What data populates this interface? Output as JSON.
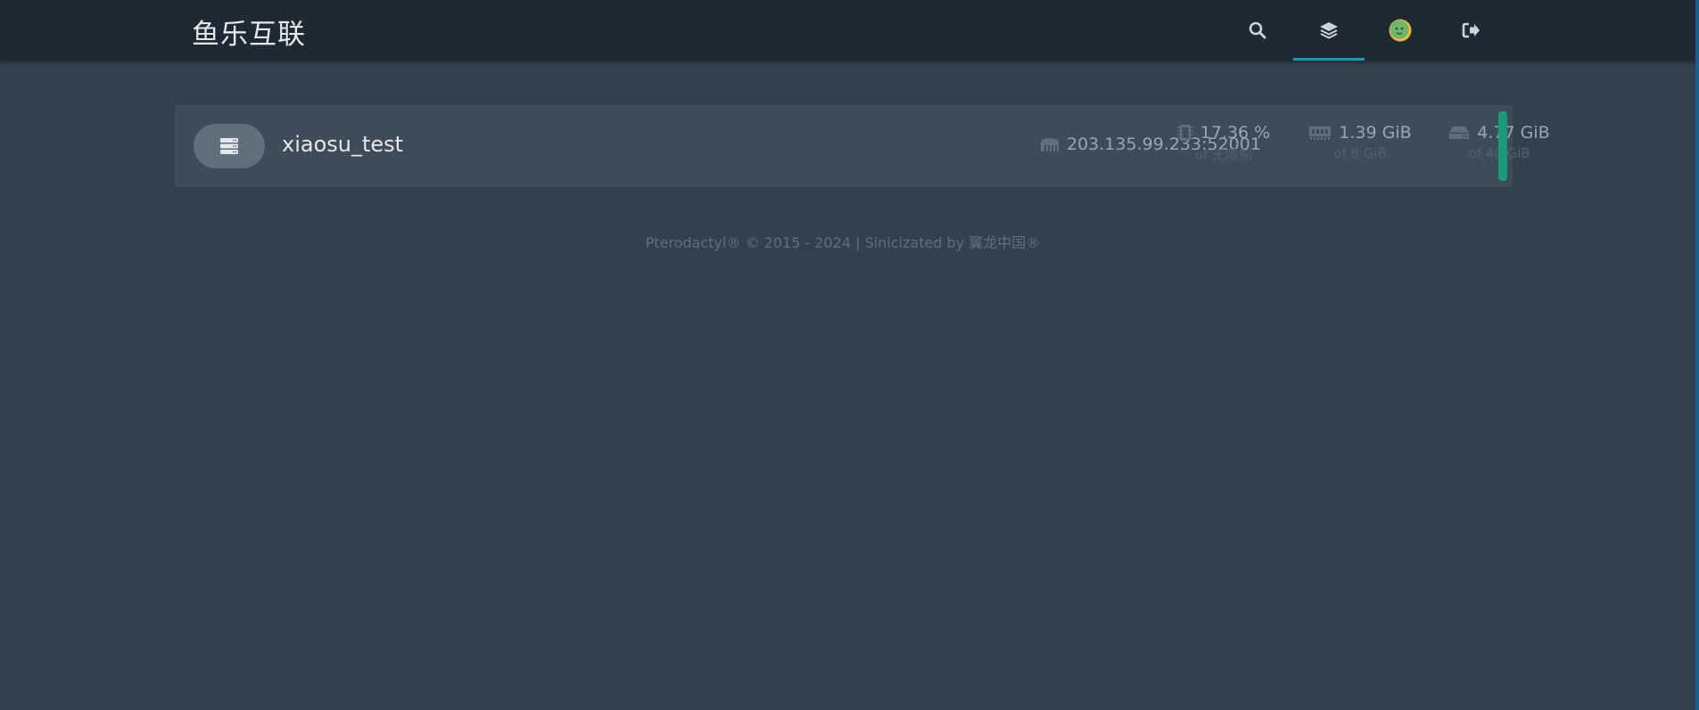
{
  "header": {
    "brand": "鱼乐互联",
    "nav": [
      {
        "icon": "search-icon",
        "active": false
      },
      {
        "icon": "layers-icon",
        "active": true
      },
      {
        "icon": "avatar",
        "active": false
      },
      {
        "icon": "sign-out-icon",
        "active": false
      }
    ]
  },
  "server": {
    "icon": "server-icon",
    "name": "xiaosu_test",
    "address_icon": "ethernet-icon",
    "address": "203.135.99.233:52001",
    "cpu": {
      "icon": "cpu-icon",
      "value": "17.36 %",
      "limit": "of 无限制"
    },
    "memory": {
      "icon": "memory-icon",
      "value": "1.39 GiB",
      "limit": "of 8 GiB"
    },
    "disk": {
      "icon": "hdd-icon",
      "value": "4.77 GiB",
      "limit": "of 40 GiB"
    },
    "status_color": "#1b9a7a"
  },
  "footer": {
    "copyright": "Pterodactyl® © 2015 - 2024",
    "separator": " | ",
    "credit": "Sinicizated by 翼龙中国®"
  },
  "colors": {
    "background": "#33404d",
    "topbar": "#1f2933",
    "card": "#3e4c59",
    "accent": "#0e9fb8",
    "status_online": "#1b9a7a"
  }
}
